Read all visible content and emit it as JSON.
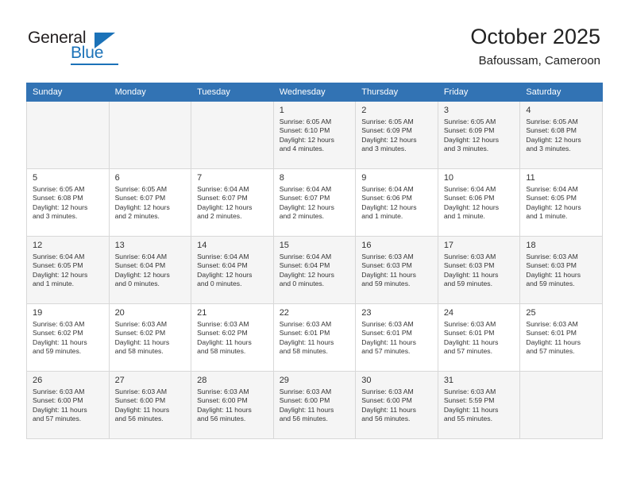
{
  "brand": {
    "name_top": "General",
    "name_bottom": "Blue"
  },
  "header": {
    "title": "October 2025",
    "subtitle": "Bafoussam, Cameroon"
  },
  "colors": {
    "header_blue": "#3273b4",
    "brand_blue": "#1b72b8",
    "shaded_row": "#f5f5f5",
    "grid_line": "#d8d8d8"
  },
  "weekday_headers": [
    "Sunday",
    "Monday",
    "Tuesday",
    "Wednesday",
    "Thursday",
    "Friday",
    "Saturday"
  ],
  "labels": {
    "sunrise": "Sunrise:",
    "sunset": "Sunset:",
    "daylight": "Daylight:"
  },
  "weeks": [
    {
      "shaded": true,
      "days": [
        {
          "empty": true
        },
        {
          "empty": true
        },
        {
          "empty": true
        },
        {
          "num": "1",
          "sunrise": "Sunrise: 6:05 AM",
          "sunset": "Sunset: 6:10 PM",
          "daylight1": "Daylight: 12 hours",
          "daylight2": "and 4 minutes."
        },
        {
          "num": "2",
          "sunrise": "Sunrise: 6:05 AM",
          "sunset": "Sunset: 6:09 PM",
          "daylight1": "Daylight: 12 hours",
          "daylight2": "and 3 minutes."
        },
        {
          "num": "3",
          "sunrise": "Sunrise: 6:05 AM",
          "sunset": "Sunset: 6:09 PM",
          "daylight1": "Daylight: 12 hours",
          "daylight2": "and 3 minutes."
        },
        {
          "num": "4",
          "sunrise": "Sunrise: 6:05 AM",
          "sunset": "Sunset: 6:08 PM",
          "daylight1": "Daylight: 12 hours",
          "daylight2": "and 3 minutes."
        }
      ]
    },
    {
      "shaded": false,
      "days": [
        {
          "num": "5",
          "sunrise": "Sunrise: 6:05 AM",
          "sunset": "Sunset: 6:08 PM",
          "daylight1": "Daylight: 12 hours",
          "daylight2": "and 3 minutes."
        },
        {
          "num": "6",
          "sunrise": "Sunrise: 6:05 AM",
          "sunset": "Sunset: 6:07 PM",
          "daylight1": "Daylight: 12 hours",
          "daylight2": "and 2 minutes."
        },
        {
          "num": "7",
          "sunrise": "Sunrise: 6:04 AM",
          "sunset": "Sunset: 6:07 PM",
          "daylight1": "Daylight: 12 hours",
          "daylight2": "and 2 minutes."
        },
        {
          "num": "8",
          "sunrise": "Sunrise: 6:04 AM",
          "sunset": "Sunset: 6:07 PM",
          "daylight1": "Daylight: 12 hours",
          "daylight2": "and 2 minutes."
        },
        {
          "num": "9",
          "sunrise": "Sunrise: 6:04 AM",
          "sunset": "Sunset: 6:06 PM",
          "daylight1": "Daylight: 12 hours",
          "daylight2": "and 1 minute."
        },
        {
          "num": "10",
          "sunrise": "Sunrise: 6:04 AM",
          "sunset": "Sunset: 6:06 PM",
          "daylight1": "Daylight: 12 hours",
          "daylight2": "and 1 minute."
        },
        {
          "num": "11",
          "sunrise": "Sunrise: 6:04 AM",
          "sunset": "Sunset: 6:05 PM",
          "daylight1": "Daylight: 12 hours",
          "daylight2": "and 1 minute."
        }
      ]
    },
    {
      "shaded": true,
      "days": [
        {
          "num": "12",
          "sunrise": "Sunrise: 6:04 AM",
          "sunset": "Sunset: 6:05 PM",
          "daylight1": "Daylight: 12 hours",
          "daylight2": "and 1 minute."
        },
        {
          "num": "13",
          "sunrise": "Sunrise: 6:04 AM",
          "sunset": "Sunset: 6:04 PM",
          "daylight1": "Daylight: 12 hours",
          "daylight2": "and 0 minutes."
        },
        {
          "num": "14",
          "sunrise": "Sunrise: 6:04 AM",
          "sunset": "Sunset: 6:04 PM",
          "daylight1": "Daylight: 12 hours",
          "daylight2": "and 0 minutes."
        },
        {
          "num": "15",
          "sunrise": "Sunrise: 6:04 AM",
          "sunset": "Sunset: 6:04 PM",
          "daylight1": "Daylight: 12 hours",
          "daylight2": "and 0 minutes."
        },
        {
          "num": "16",
          "sunrise": "Sunrise: 6:03 AM",
          "sunset": "Sunset: 6:03 PM",
          "daylight1": "Daylight: 11 hours",
          "daylight2": "and 59 minutes."
        },
        {
          "num": "17",
          "sunrise": "Sunrise: 6:03 AM",
          "sunset": "Sunset: 6:03 PM",
          "daylight1": "Daylight: 11 hours",
          "daylight2": "and 59 minutes."
        },
        {
          "num": "18",
          "sunrise": "Sunrise: 6:03 AM",
          "sunset": "Sunset: 6:03 PM",
          "daylight1": "Daylight: 11 hours",
          "daylight2": "and 59 minutes."
        }
      ]
    },
    {
      "shaded": false,
      "days": [
        {
          "num": "19",
          "sunrise": "Sunrise: 6:03 AM",
          "sunset": "Sunset: 6:02 PM",
          "daylight1": "Daylight: 11 hours",
          "daylight2": "and 59 minutes."
        },
        {
          "num": "20",
          "sunrise": "Sunrise: 6:03 AM",
          "sunset": "Sunset: 6:02 PM",
          "daylight1": "Daylight: 11 hours",
          "daylight2": "and 58 minutes."
        },
        {
          "num": "21",
          "sunrise": "Sunrise: 6:03 AM",
          "sunset": "Sunset: 6:02 PM",
          "daylight1": "Daylight: 11 hours",
          "daylight2": "and 58 minutes."
        },
        {
          "num": "22",
          "sunrise": "Sunrise: 6:03 AM",
          "sunset": "Sunset: 6:01 PM",
          "daylight1": "Daylight: 11 hours",
          "daylight2": "and 58 minutes."
        },
        {
          "num": "23",
          "sunrise": "Sunrise: 6:03 AM",
          "sunset": "Sunset: 6:01 PM",
          "daylight1": "Daylight: 11 hours",
          "daylight2": "and 57 minutes."
        },
        {
          "num": "24",
          "sunrise": "Sunrise: 6:03 AM",
          "sunset": "Sunset: 6:01 PM",
          "daylight1": "Daylight: 11 hours",
          "daylight2": "and 57 minutes."
        },
        {
          "num": "25",
          "sunrise": "Sunrise: 6:03 AM",
          "sunset": "Sunset: 6:01 PM",
          "daylight1": "Daylight: 11 hours",
          "daylight2": "and 57 minutes."
        }
      ]
    },
    {
      "shaded": true,
      "days": [
        {
          "num": "26",
          "sunrise": "Sunrise: 6:03 AM",
          "sunset": "Sunset: 6:00 PM",
          "daylight1": "Daylight: 11 hours",
          "daylight2": "and 57 minutes."
        },
        {
          "num": "27",
          "sunrise": "Sunrise: 6:03 AM",
          "sunset": "Sunset: 6:00 PM",
          "daylight1": "Daylight: 11 hours",
          "daylight2": "and 56 minutes."
        },
        {
          "num": "28",
          "sunrise": "Sunrise: 6:03 AM",
          "sunset": "Sunset: 6:00 PM",
          "daylight1": "Daylight: 11 hours",
          "daylight2": "and 56 minutes."
        },
        {
          "num": "29",
          "sunrise": "Sunrise: 6:03 AM",
          "sunset": "Sunset: 6:00 PM",
          "daylight1": "Daylight: 11 hours",
          "daylight2": "and 56 minutes."
        },
        {
          "num": "30",
          "sunrise": "Sunrise: 6:03 AM",
          "sunset": "Sunset: 6:00 PM",
          "daylight1": "Daylight: 11 hours",
          "daylight2": "and 56 minutes."
        },
        {
          "num": "31",
          "sunrise": "Sunrise: 6:03 AM",
          "sunset": "Sunset: 5:59 PM",
          "daylight1": "Daylight: 11 hours",
          "daylight2": "and 55 minutes."
        },
        {
          "empty": true
        }
      ]
    }
  ]
}
